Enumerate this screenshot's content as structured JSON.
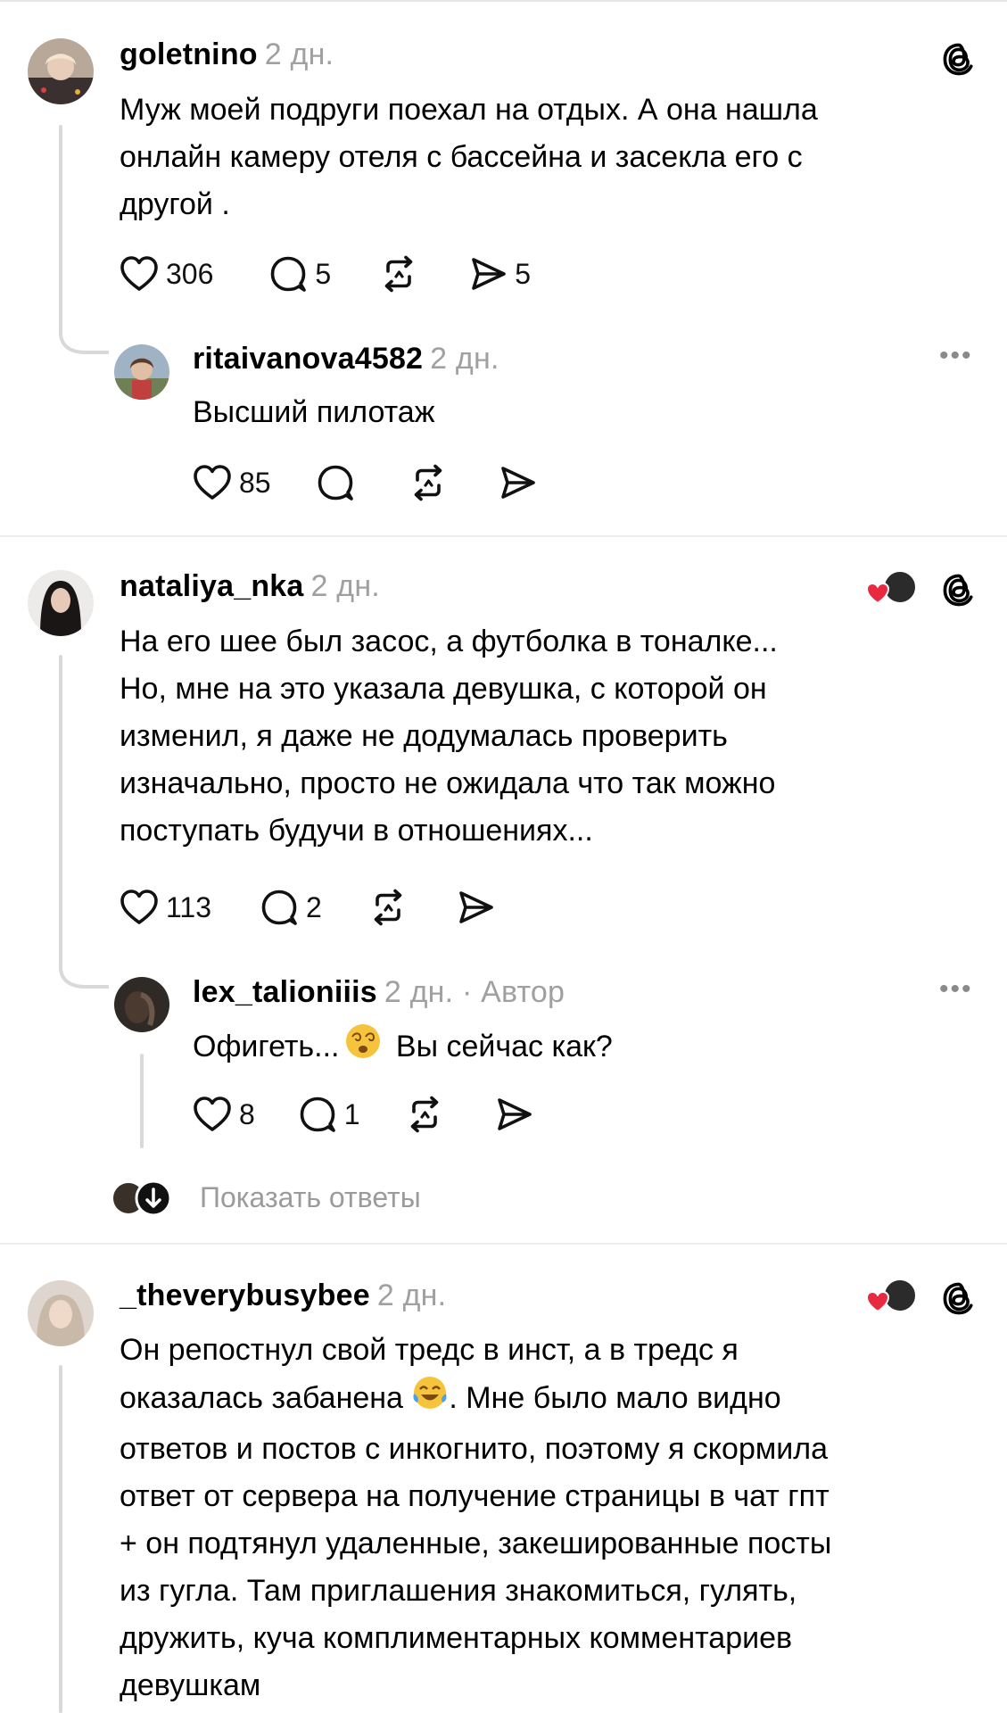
{
  "posts": [
    {
      "username": "goletnino",
      "time": "2 дн.",
      "text_lines": [
        "Муж моей подруги поехал на отдых. А она нашла",
        "онлайн камеру отеля с бассейна  и засекла  его с",
        "другой ."
      ],
      "likes": "306",
      "replies": "5",
      "shares": "5",
      "reply": {
        "username": "ritaivanova4582",
        "time": "2 дн.",
        "text": "Высший пилотаж",
        "likes": "85"
      }
    },
    {
      "username": "nataliya_nka",
      "time": "2 дн.",
      "text_lines": [
        "На его шее был засос, а футболка в тоналке...",
        "Но, мне на это указала девушка, с которой он",
        "изменил, я даже не додумалась проверить",
        "изначально, просто не ожидала что так можно",
        "поступать будучи в отношениях..."
      ],
      "likes": "113",
      "replies": "2",
      "reply": {
        "username": "lex_talioniiis",
        "time": "2 дн.",
        "author_label": "· Автор",
        "text_before_emoji": "Офигеть...",
        "text_after_emoji": " Вы сейчас как?",
        "likes": "8",
        "replies": "1"
      },
      "show_replies": "Показать ответы"
    },
    {
      "username": "_theverybusybee",
      "time": "2 дн.",
      "line1": "Он репостнул свой тредс в инст, а в тредс я",
      "line2_before_emoji": "оказалась забанена ",
      "line2_after_emoji": ". Мне было мало видно",
      "text_lines_rest": [
        "ответов и постов с инкогнито, поэтому я скормила",
        "ответ от сервера на получение страницы в чат гпт",
        "+ он подтянул удаленные, закешированные посты",
        "из гугла. Там приглашения знакомиться, гулять,",
        "дружить, куча комплиментарных комментариев",
        "девушкам"
      ]
    }
  ],
  "icons": {
    "like": "heart-icon",
    "reply": "comment-icon",
    "repost": "repost-icon",
    "share": "share-icon",
    "threads": "threads-logo-icon",
    "more": "more-icon"
  },
  "colors": {
    "text": "#000000",
    "muted": "#a0a0a0",
    "separator": "#ececec",
    "heart_badge": "#e8293f"
  }
}
